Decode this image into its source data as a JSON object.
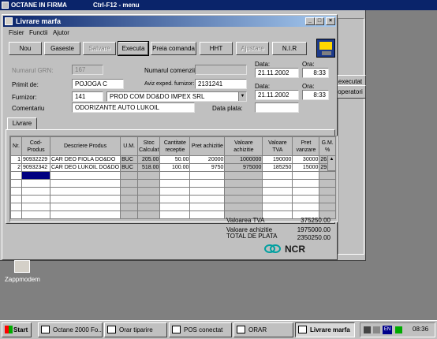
{
  "desktop": {
    "bg_title": "OCTANE IN FIRMA",
    "bg_shortcut": "Ctrl-F12 - menu",
    "icon_label": "Zappmodem",
    "side_buttons": [
      "executat",
      "operatori"
    ]
  },
  "window": {
    "title": "Livrare marfa",
    "menu": [
      "Fisier",
      "Functii",
      "Ajutor"
    ],
    "toolbar": [
      "Nou",
      "Gaseste",
      "Salvare",
      "Executa",
      "Preia comanda",
      "HHT",
      "Ajustare",
      "N.I.R"
    ],
    "form": {
      "numarul_grn_label": "Numarul GRN:",
      "numarul_grn": "167",
      "numarul_comenzii_label": "Numarul comenzii:",
      "numarul_comenzii": "",
      "primit_de_label": "Primit de:",
      "primit_de": "POJOGA C",
      "aviz_label": "Aviz exped. furnizor:",
      "aviz": "2131241",
      "furnizor_label": "Furnizor:",
      "furnizor_cod": "141",
      "furnizor_nume": "PROD COM DO&DO IMPEX SRL",
      "comentariu_label": "Comentariu",
      "comentariu": "ODORIZANTE AUTO LUKOIL",
      "data_label": "Data:",
      "data1": "21.11.2002",
      "ora_label": "Ora:",
      "ora1": "8:33",
      "data2": "21.11.2002",
      "ora2": "8:33",
      "data_plata_label": "Data plata:",
      "data_plata": ""
    },
    "tab": "Livrare",
    "table": {
      "headers": [
        "Nr.",
        "Cod-Produs",
        "Descriere Produs",
        "U.M.",
        "Stoc Calculat",
        "Cantitate receptie",
        "Pret achizitie",
        "Valoare achizitie",
        "Valoare TVA",
        "Pret vanzare",
        "G.M. %"
      ],
      "rows": [
        [
          "1",
          "90932229",
          "CAR DEO FIOLA DO&DO",
          "BUC",
          "205.00",
          "50.00",
          "20000",
          "1000000",
          "190000",
          "30000",
          "26.05"
        ],
        [
          "2",
          "90932342",
          "CAR DEO LUKOIL DO&DO",
          "BUC",
          "518.00",
          "100.00",
          "9750",
          "975000",
          "185250",
          "15000",
          "29.28"
        ]
      ]
    },
    "totals": {
      "tva_label": "Valoarea TVA",
      "tva": "375250.00",
      "achizitie_label": "Valoare achizitie",
      "achizitie": "1975000.00",
      "plata_label": "TOTAL DE PLATA",
      "plata": "2350250.00"
    },
    "brand": "NCR"
  },
  "taskbar": {
    "start": "Start",
    "tasks": [
      "Octane 2000 Fo...",
      "Orar tiparire",
      "POS conectat",
      "ORAR",
      "Livrare marfa"
    ],
    "tray_lang": "EN",
    "clock": "08:36"
  }
}
